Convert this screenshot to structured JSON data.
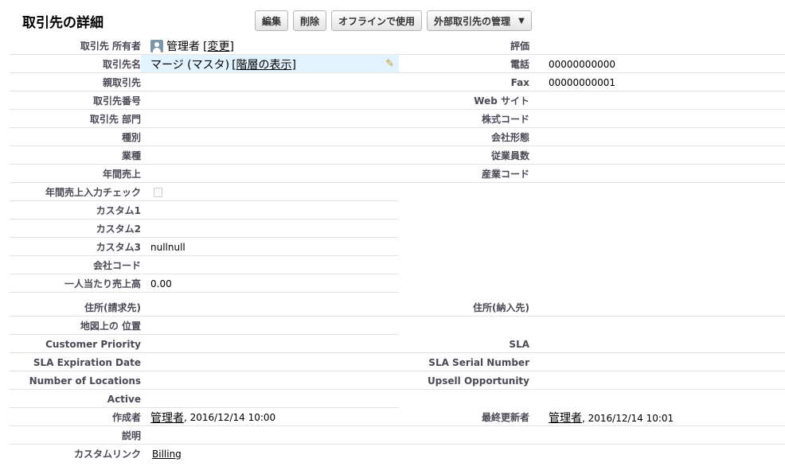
{
  "header": {
    "title": "取引先の詳細",
    "buttons": {
      "edit": "編集",
      "delete": "削除",
      "offline": "オフラインで使用",
      "external": "外部取引先の管理"
    }
  },
  "left_fields": {
    "owner": {
      "label": "取引先 所有者",
      "value": "管理者",
      "change_link": "[変更]"
    },
    "name": {
      "label": "取引先名",
      "value": "マージ (マスタ)",
      "hierarchy_link": "[階層の表示]"
    },
    "parent": {
      "label": "親取引先",
      "value": ""
    },
    "number": {
      "label": "取引先番号",
      "value": ""
    },
    "division": {
      "label": "取引先 部門",
      "value": ""
    },
    "type": {
      "label": "種別",
      "value": ""
    },
    "industry": {
      "label": "業種",
      "value": ""
    },
    "revenue": {
      "label": "年間売上",
      "value": ""
    },
    "revenue_check": {
      "label": "年間売上入力チェック"
    },
    "custom1": {
      "label": "カスタム1",
      "value": ""
    },
    "custom2": {
      "label": "カスタム2",
      "value": ""
    },
    "custom3": {
      "label": "カスタム3",
      "value": "nullnull"
    },
    "company_code": {
      "label": "会社コード",
      "value": ""
    },
    "per_person": {
      "label": "一人当たり売上高",
      "value": "0.00"
    }
  },
  "right_fields": {
    "rating": {
      "label": "評価",
      "value": ""
    },
    "phone": {
      "label": "電話",
      "value": "00000000000"
    },
    "fax": {
      "label": "Fax",
      "value": "00000000001"
    },
    "website": {
      "label": "Web サイト",
      "value": ""
    },
    "ticker": {
      "label": "株式コード",
      "value": ""
    },
    "ownership": {
      "label": "会社形態",
      "value": ""
    },
    "employees": {
      "label": "従業員数",
      "value": ""
    },
    "sic": {
      "label": "産業コード",
      "value": ""
    }
  },
  "bottom_fields": {
    "billing": {
      "label": "住所(請求先)",
      "value": ""
    },
    "shipping": {
      "label": "住所(納入先)",
      "value": ""
    },
    "map": {
      "label": "地図上の 位置",
      "value": ""
    },
    "customer_priority": {
      "label": "Customer Priority",
      "value": ""
    },
    "sla": {
      "label": "SLA",
      "value": ""
    },
    "sla_expiration": {
      "label": "SLA Expiration Date",
      "value": ""
    },
    "sla_serial": {
      "label": "SLA Serial Number",
      "value": ""
    },
    "num_locations": {
      "label": "Number of Locations",
      "value": ""
    },
    "upsell": {
      "label": "Upsell Opportunity",
      "value": ""
    },
    "active": {
      "label": "Active",
      "value": ""
    },
    "created_by": {
      "label": "作成者",
      "user": "管理者",
      "date": ", 2016/12/14 10:00"
    },
    "modified_by": {
      "label": "最終更新者",
      "user": "管理者",
      "date": ", 2016/12/14 10:01"
    },
    "description": {
      "label": "説明",
      "value": ""
    },
    "custom_links": {
      "label": "カスタムリンク",
      "link": "Billing"
    }
  },
  "colors": {
    "label_text": "#4a4a56",
    "highlight_bg": "#e3f3ff",
    "row_border": "#e3e3e3",
    "button_border": "#b5b5b5"
  }
}
